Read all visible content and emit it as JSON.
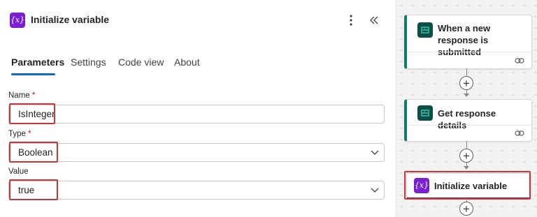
{
  "panel": {
    "title": "Initialize variable",
    "icon_text": "{x}",
    "icon_name": "variable-icon",
    "more_icon": "more-vertical-icon",
    "collapse_icon": "collapse-double-chevron-icon"
  },
  "tabs": [
    {
      "label": "Parameters",
      "active": true
    },
    {
      "label": "Settings",
      "active": false
    },
    {
      "label": "Code view",
      "active": false
    },
    {
      "label": "About",
      "active": false
    }
  ],
  "fields": {
    "name": {
      "label": "Name",
      "required_mark": "*",
      "value": "IsInteger"
    },
    "type": {
      "label": "Type",
      "required_mark": "*",
      "value": "Boolean"
    },
    "value": {
      "label": "Value",
      "value": "true"
    }
  },
  "flow": {
    "steps": [
      {
        "title": "When a new response is submitted",
        "icon": "forms-icon"
      },
      {
        "title": "Get response details",
        "icon": "forms-icon"
      },
      {
        "title": "Initialize variable",
        "icon_text": "{x}",
        "icon": "variable-icon"
      }
    ]
  },
  "colors": {
    "accent": "#0f6cbd",
    "highlight": "#d13438",
    "variable": "#7a1fd1",
    "forms": "#0b4f46",
    "trigger_border": "#0f7b6c"
  }
}
